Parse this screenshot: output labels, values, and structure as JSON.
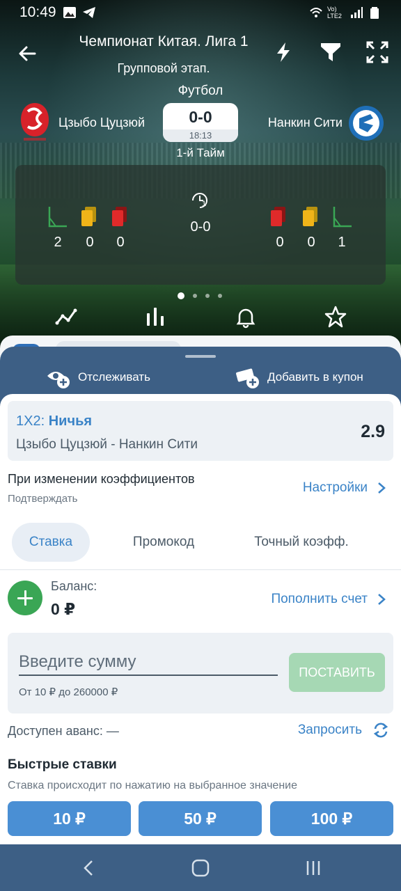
{
  "status": {
    "time": "10:49",
    "network": "Vo) LTE2"
  },
  "header": {
    "title": "Чемпионат Китая. Лига 1",
    "subtitle": "Групповой этап."
  },
  "match": {
    "sport": "Футбол",
    "home": "Цзыбо Цуцзюй",
    "away": "Нанкин Сити",
    "score": "0-0",
    "time": "18:13",
    "period": "1-й Тайм",
    "half_number": "1",
    "half_score": "0-0",
    "home_stats": {
      "corners": "2",
      "yellow": "0",
      "red": "0"
    },
    "away_stats": {
      "red": "0",
      "yellow": "0",
      "corners": "1"
    }
  },
  "sheet": {
    "track_label": "Отслеживать",
    "add_coupon_label": "Добавить в купон"
  },
  "bet": {
    "market": "1X2:",
    "selection": "Ничья",
    "match": "Цзыбо Цуцзюй - Нанкин Сити",
    "odds": "2.9"
  },
  "odds_change": {
    "title": "При изменении коэффициентов",
    "value": "Подтверждать",
    "settings_label": "Настройки"
  },
  "tabs": [
    "Ставка",
    "Промокод",
    "Точный коэфф."
  ],
  "balance": {
    "label": "Баланс:",
    "value": "0 ₽",
    "topup_label": "Пополнить счет"
  },
  "amount": {
    "placeholder": "Введите сумму",
    "range": "От 10 ₽ до 260000 ₽",
    "place_label": "ПОСТАВИТЬ"
  },
  "advance": {
    "label": "Доступен аванс: —",
    "request_label": "Запросить"
  },
  "quick": {
    "title": "Быстрые ставки",
    "subtitle": "Ставка происходит по нажатию на выбранное значение",
    "amounts": [
      "10 ₽",
      "50 ₽",
      "100 ₽"
    ]
  },
  "colors": {
    "accent": "#3a83c7",
    "sheet": "#3d5f85",
    "success": "#3aa655",
    "quick_button": "#4a8fd4"
  }
}
